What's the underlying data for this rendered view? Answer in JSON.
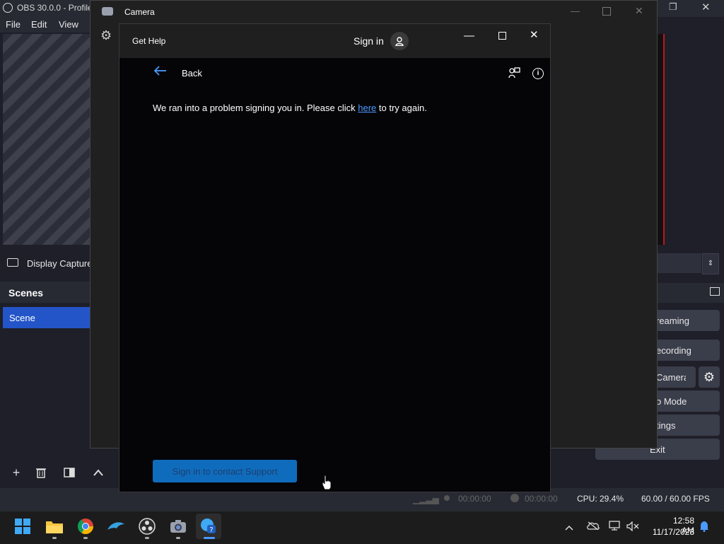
{
  "obs": {
    "title": "OBS 30.0.0 - Profile",
    "menu": [
      "File",
      "Edit",
      "View"
    ],
    "source_name": "Display Capture",
    "scenes_header": "Scenes",
    "scene_item": "Scene",
    "controls": {
      "streaming": "reaming",
      "recording": "ecording",
      "camera": "Camera",
      "mode": "o Mode",
      "settings": "tings",
      "exit": "Exit"
    },
    "status": {
      "stream_time": "00:00:00",
      "record_time": "00:00:00",
      "cpu": "CPU: 29.4%",
      "fps": "60.00 / 60.00 FPS"
    }
  },
  "camera_window": {
    "title": "Camera"
  },
  "help_window": {
    "title": "Get Help",
    "sign_in": "Sign in",
    "back": "Back",
    "message_before": "We ran into a problem signing you in. Please click ",
    "message_link": "here",
    "message_after": " to try again.",
    "support_button": "Sign in to contact Support"
  },
  "taskbar": {
    "time": "12:58 AM",
    "date": "11/17/2023"
  },
  "colors": {
    "accent": "#0f6cbd",
    "link": "#4c9aff",
    "scene_selected": "#2455c8",
    "obs_red": "#c4141c"
  }
}
